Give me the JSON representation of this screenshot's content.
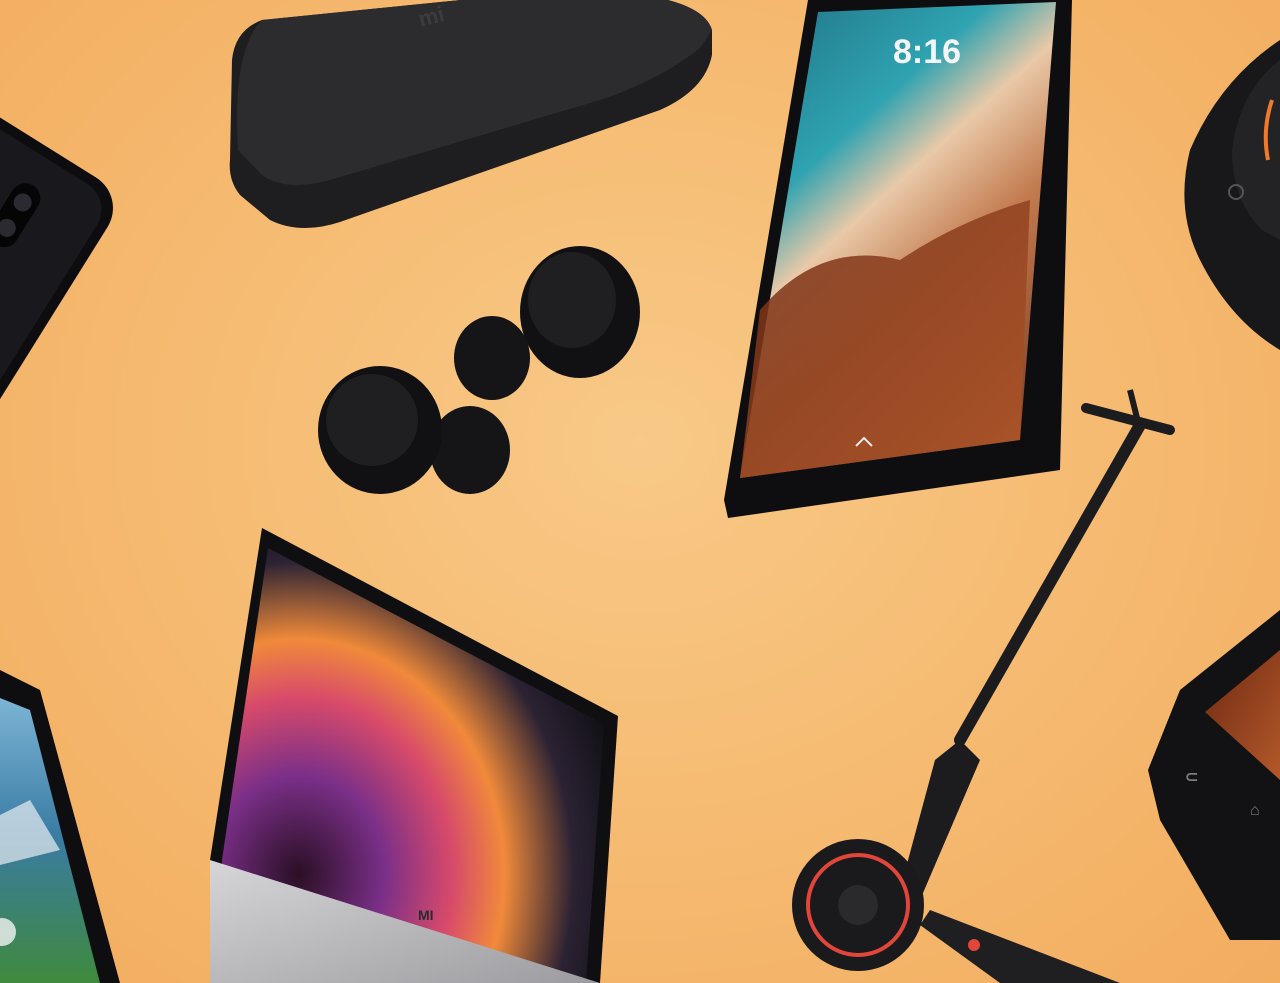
{
  "products": {
    "tv_box": {
      "brand_text": "mi"
    },
    "tablet": {
      "clock_time": "8:16"
    },
    "laptop": {
      "brand_text": "MI"
    }
  },
  "colors": {
    "background": "#f5b86e",
    "device_black": "#1b1b1d",
    "scooter_accent": "#e0463a"
  },
  "icons": [
    "phone-icon",
    "tv-box-icon",
    "earbuds-icon",
    "tablet-icon",
    "laptop-icon",
    "scooter-icon",
    "smart-speaker-icon"
  ]
}
